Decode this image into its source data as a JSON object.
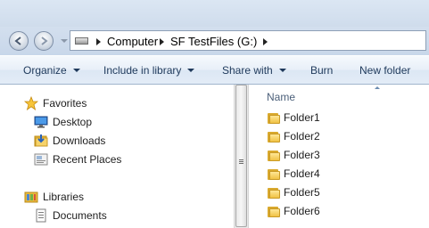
{
  "address": {
    "breadcrumbs": [
      "Computer",
      "SF TestFiles (G:)"
    ],
    "drive_icon": "drive-icon"
  },
  "toolbar": {
    "organize": "Organize",
    "include_in_library": "Include in library",
    "share_with": "Share with",
    "burn": "Burn",
    "new_folder": "New folder"
  },
  "nav": {
    "favorites": {
      "label": "Favorites",
      "icon": "star-icon"
    },
    "favorites_items": [
      {
        "label": "Desktop",
        "icon": "desktop-icon"
      },
      {
        "label": "Downloads",
        "icon": "downloads-icon"
      },
      {
        "label": "Recent Places",
        "icon": "recent-places-icon"
      }
    ],
    "libraries": {
      "label": "Libraries",
      "icon": "libraries-icon"
    },
    "libraries_items": [
      {
        "label": "Documents",
        "icon": "documents-icon"
      }
    ]
  },
  "filelist": {
    "column_name": "Name",
    "items": [
      "Folder1",
      "Folder2",
      "Folder3",
      "Folder4",
      "Folder5",
      "Folder6"
    ]
  },
  "colors": {
    "toolbar_text": "#1e395b",
    "folder_yellow": "#f0c245"
  }
}
